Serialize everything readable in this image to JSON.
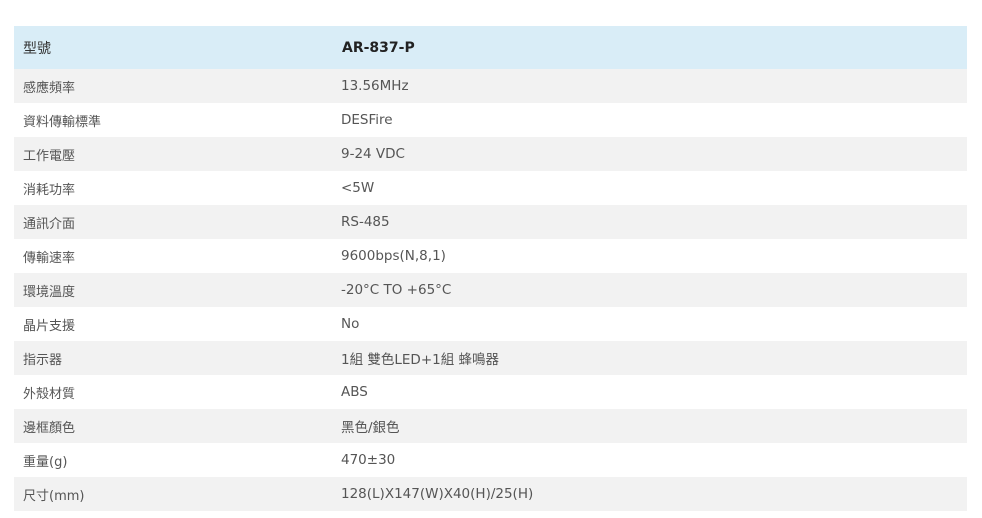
{
  "header": {
    "label": "型號",
    "value": "AR-837-P"
  },
  "rows": [
    {
      "label": "感應頻率",
      "value": "13.56MHz"
    },
    {
      "label": "資料傳輸標準",
      "value": "DESFire"
    },
    {
      "label": "工作電壓",
      "value": "9-24 VDC"
    },
    {
      "label": "消耗功率",
      "value": "<5W"
    },
    {
      "label": "通訊介面",
      "value": "RS-485"
    },
    {
      "label": "傳輸速率",
      "value": "9600bps(N,8,1)"
    },
    {
      "label": "環境溫度",
      "value": "-20°C TO +65°C"
    },
    {
      "label": "晶片支援",
      "value": "No"
    },
    {
      "label": "指示器",
      "value": "1組 雙色LED+1組 蜂鳴器"
    },
    {
      "label": "外殼材質",
      "value": "ABS"
    },
    {
      "label": "邊框顏色",
      "value": "黑色/銀色"
    },
    {
      "label": "重量(g)",
      "value": "470±30"
    },
    {
      "label": "尺寸(mm)",
      "value": "128(L)X147(W)X40(H)/25(H)"
    }
  ],
  "colors": {
    "header_bg": "#d9edf7",
    "stripe_bg": "#f2f2f2",
    "text": "#555555"
  }
}
